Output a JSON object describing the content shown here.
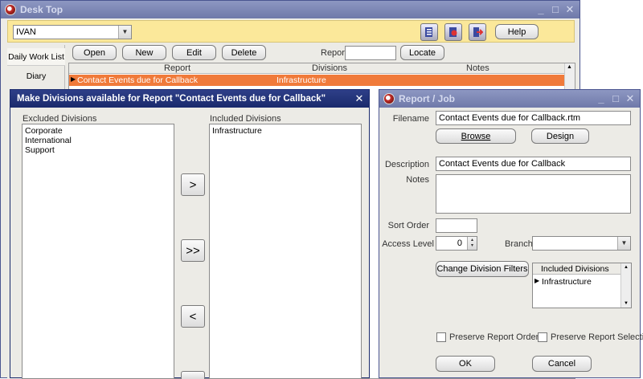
{
  "desktop": {
    "title": "Desk Top",
    "user_select": "IVAN",
    "help_label": "Help",
    "tabs": [
      "Daily Work List",
      "Diary"
    ],
    "toolbar": {
      "open": "Open",
      "new": "New",
      "edit": "Edit",
      "delete": "Delete",
      "report_label": "Report",
      "report_value": "",
      "locate": "Locate"
    },
    "grid": {
      "columns": [
        "Report",
        "Divisions",
        "Notes"
      ],
      "rows": [
        {
          "report": "Contact Events due for Callback",
          "divisions": "Infrastructure",
          "notes": ""
        }
      ]
    }
  },
  "divisions_dialog": {
    "title": "Make Divisions available for Report \"Contact Events due for Callback\"",
    "excluded_label": "Excluded Divisions",
    "included_label": "Included Divisions",
    "excluded": [
      "Corporate",
      "International",
      "Support"
    ],
    "included": [
      "Infrastructure"
    ],
    "move_right": ">",
    "move_all_right": ">>",
    "move_left": "<"
  },
  "report_job": {
    "title": "Report / Job",
    "filename_label": "Filename",
    "filename_value": "Contact Events due for Callback.rtm",
    "browse": "Browse",
    "design": "Design",
    "description_label": "Description",
    "description_value": "Contact Events due for Callback",
    "notes_label": "Notes",
    "notes_value": "",
    "sort_order_label": "Sort Order",
    "sort_order_value": "",
    "access_level_label": "Access Level",
    "access_level_value": "0",
    "branch_label": "Branch",
    "branch_value": "",
    "change_filters": "Change Division Filters",
    "included_header": "Included Divisions",
    "included": [
      "Infrastructure"
    ],
    "preserve_order": "Preserve Report Order",
    "preserve_selection": "Preserve Report Selection",
    "ok": "OK",
    "cancel": "Cancel"
  },
  "colors": {
    "title_bar": "#1a2a6c",
    "toolbar_bg": "#fbe89a",
    "selected_row": "#f07a3a",
    "dialog_bg": "#ecebe6"
  }
}
